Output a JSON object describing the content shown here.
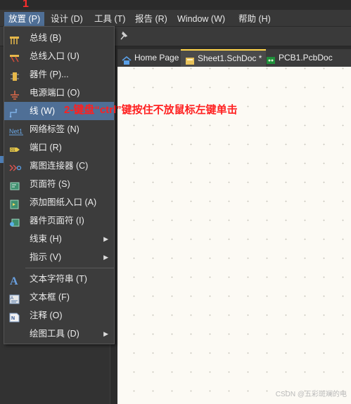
{
  "annotations": {
    "step1": "1",
    "step2": "2-键盘“ctrl”键按住不放鼠标左键单击"
  },
  "menubar": {
    "items": [
      "放置 (P)",
      "设计 (D)",
      "工具 (T)",
      "报告 (R)",
      "Window (W)",
      "帮助 (H)"
    ]
  },
  "tabs": [
    "Home Page",
    "Sheet1.SchDoc *",
    "PCB1.PcbDoc"
  ],
  "place_menu": {
    "items": [
      {
        "label": "总线 (B)",
        "icon": "bus-icon"
      },
      {
        "label": "总线入口 (U)",
        "icon": "bus-entry-icon"
      },
      {
        "label": "器件 (P)...",
        "icon": "part-icon"
      },
      {
        "label": "电源端口 (O)",
        "icon": "power-port-icon"
      },
      {
        "label": "线 (W)",
        "icon": "wire-icon"
      },
      {
        "label": "网络标签 (N)",
        "icon": "net-label-icon"
      },
      {
        "label": "端口 (R)",
        "icon": "port-icon"
      },
      {
        "label": "离图连接器 (C)",
        "icon": "off-sheet-connector-icon"
      },
      {
        "label": "页面符 (S)",
        "icon": "sheet-symbol-icon"
      },
      {
        "label": "添加图纸入口 (A)",
        "icon": "sheet-entry-icon"
      },
      {
        "label": "器件页面符 (I)",
        "icon": "device-sheet-symbol-icon"
      },
      {
        "label": "线束 (H)",
        "icon": "",
        "submenu": true
      },
      {
        "label": "指示 (V)",
        "icon": "",
        "submenu": true
      },
      {
        "label": "文本字符串 (T)",
        "icon": "text-string-icon"
      },
      {
        "label": "文本框 (F)",
        "icon": "text-frame-icon"
      },
      {
        "label": "注释 (O)",
        "icon": "note-icon"
      },
      {
        "label": "绘图工具 (D)",
        "icon": "",
        "submenu": true
      }
    ]
  },
  "watermark": "CSDN @五彩斑斓的电",
  "colors": {
    "highlight": "#4f6f96",
    "annotation": "#ff2020",
    "canvas": "#fcfaf4",
    "active_tab_marker": "#ffd54a"
  }
}
